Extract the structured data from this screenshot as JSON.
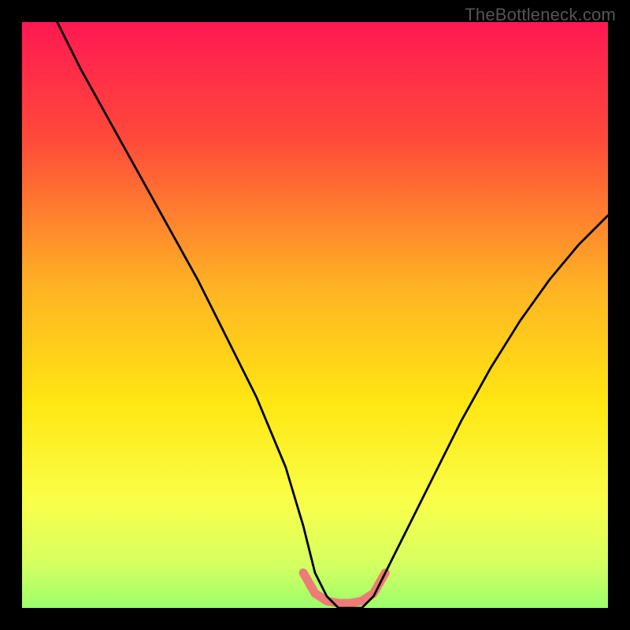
{
  "watermark": "TheBottleneck.com",
  "chart_data": {
    "type": "line",
    "title": "",
    "xlabel": "",
    "ylabel": "",
    "xlim": [
      0,
      100
    ],
    "ylim": [
      0,
      100
    ],
    "series": [
      {
        "name": "mismatch-curve",
        "x": [
          6,
          10,
          15,
          20,
          25,
          30,
          35,
          40,
          45,
          48,
          50,
          52,
          54,
          56,
          58,
          60,
          62,
          65,
          70,
          75,
          80,
          85,
          90,
          95,
          100
        ],
        "values": [
          100,
          92,
          83,
          74,
          65,
          56,
          46,
          36,
          24,
          14,
          6,
          2,
          0,
          0,
          0,
          2,
          6,
          12,
          22,
          32,
          41,
          49,
          56,
          62,
          67
        ]
      },
      {
        "name": "optimal-zone",
        "x": [
          48,
          50,
          52,
          54,
          56,
          58,
          60,
          62
        ],
        "values": [
          6,
          2.5,
          1.2,
          0.8,
          0.8,
          1.2,
          2.5,
          6
        ]
      }
    ],
    "gradient_stops": [
      {
        "offset": 0,
        "color": "#ff1852"
      },
      {
        "offset": 20,
        "color": "#ff4a3a"
      },
      {
        "offset": 45,
        "color": "#ffb224"
      },
      {
        "offset": 65,
        "color": "#ffe712"
      },
      {
        "offset": 82,
        "color": "#f9ff4a"
      },
      {
        "offset": 92,
        "color": "#d8ff60"
      },
      {
        "offset": 100,
        "color": "#9cff6c"
      }
    ]
  }
}
